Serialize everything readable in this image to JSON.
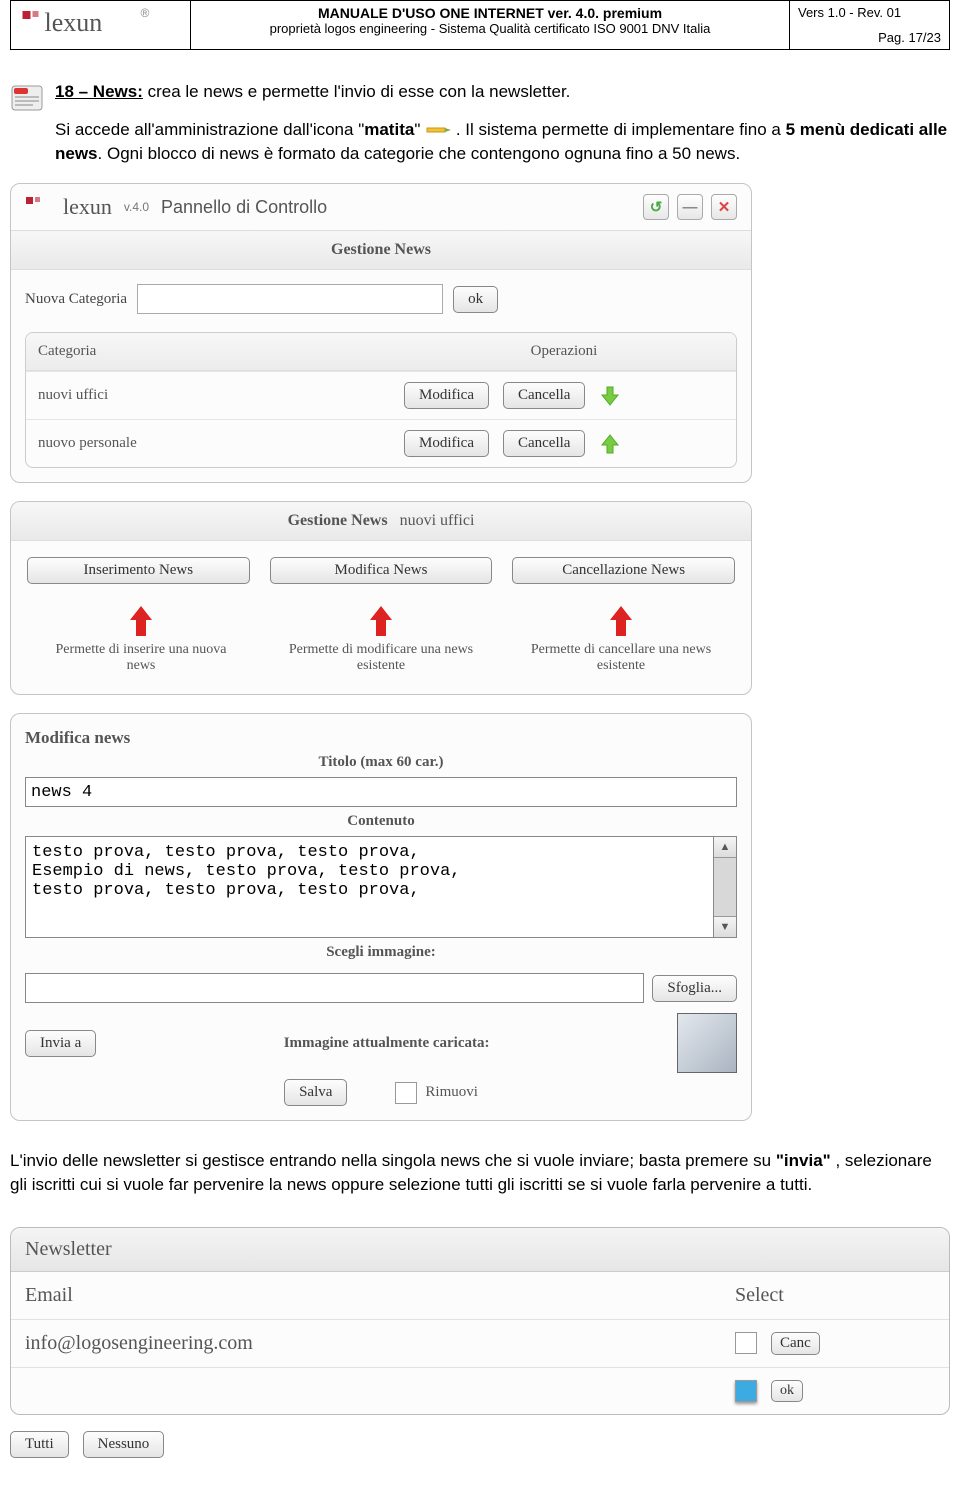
{
  "header": {
    "title": "MANUALE D'USO ONE INTERNET ver. 4.0. premium",
    "subtitle": "proprietà logos engineering -  Sistema Qualità  certificato ISO 9001 DNV Italia",
    "version": "Vers 1.0 - Rev. 01",
    "page": "Pag. 17/23",
    "logo_text": "lexun"
  },
  "intro": {
    "label": "18 – News:",
    "text1": " crea le news e permette l'invio di esse con la newsletter.",
    "line2a": "Si accede all'amministrazione dall'icona \"",
    "bold_matita": "matita",
    "line2b": "\" ",
    "line2c": ". Il sistema permette di implementare fino a ",
    "bold_5menu": "5 menù dedicati alle news",
    "line2d": ". Ogni blocco di news è formato da categorie che contengono ognuna fino a 50 news."
  },
  "panel1": {
    "brand": "lexun",
    "ver": "v.4.0",
    "title": "Pannello di Controllo",
    "section": "Gestione News",
    "newcat_label": "Nuova Categoria",
    "ok": "ok",
    "col_cat": "Categoria",
    "col_ops": "Operazioni",
    "rows": [
      {
        "name": "nuovi uffici",
        "mod": "Modifica",
        "canc": "Cancella",
        "dir": "down"
      },
      {
        "name": "nuovo personale",
        "mod": "Modifica",
        "canc": "Cancella",
        "dir": "up"
      }
    ]
  },
  "panel2": {
    "section": "Gestione News",
    "sub": "nuovi uffici",
    "btn_ins": "Inserimento News",
    "btn_mod": "Modifica News",
    "btn_canc": "Cancellazione News",
    "hint_ins": "Permette di inserire una nuova news",
    "hint_mod": "Permette di modificare una news esistente",
    "hint_canc": "Permette di cancellare una news esistente"
  },
  "panel3": {
    "heading": "Modifica news",
    "titolo_lbl": "Titolo (max 60 car.)",
    "titolo_val": "news 4",
    "contenuto_lbl": "Contenuto",
    "contenuto_val": "testo prova, testo prova, testo prova,\nEsempio di news, testo prova, testo prova,\ntesto prova, testo prova, testo prova,",
    "scegli_lbl": "Scegli immagine:",
    "sfoglia": "Sfoglia...",
    "invia_a": "Invia a",
    "img_curr": "Immagine attualmente caricata:",
    "salva": "Salva",
    "rimuovi": "Rimuovi"
  },
  "outro": {
    "t1": "L'invio delle newsletter si gestisce entrando nella singola news che si vuole inviare; basta premere su ",
    "b1": "\"invia\"",
    "t2": " , selezionare gli iscritti cui si vuole far pervenire la news oppure selezione tutti gli iscritti se si vuole farla pervenire a tutti."
  },
  "newsletter": {
    "title": "Newsletter",
    "col_email": "Email",
    "col_select": "Select",
    "email": "info@logosengineering.com",
    "canc": "Canc",
    "ok": "ok",
    "tutti": "Tutti",
    "nessuno": "Nessuno"
  }
}
